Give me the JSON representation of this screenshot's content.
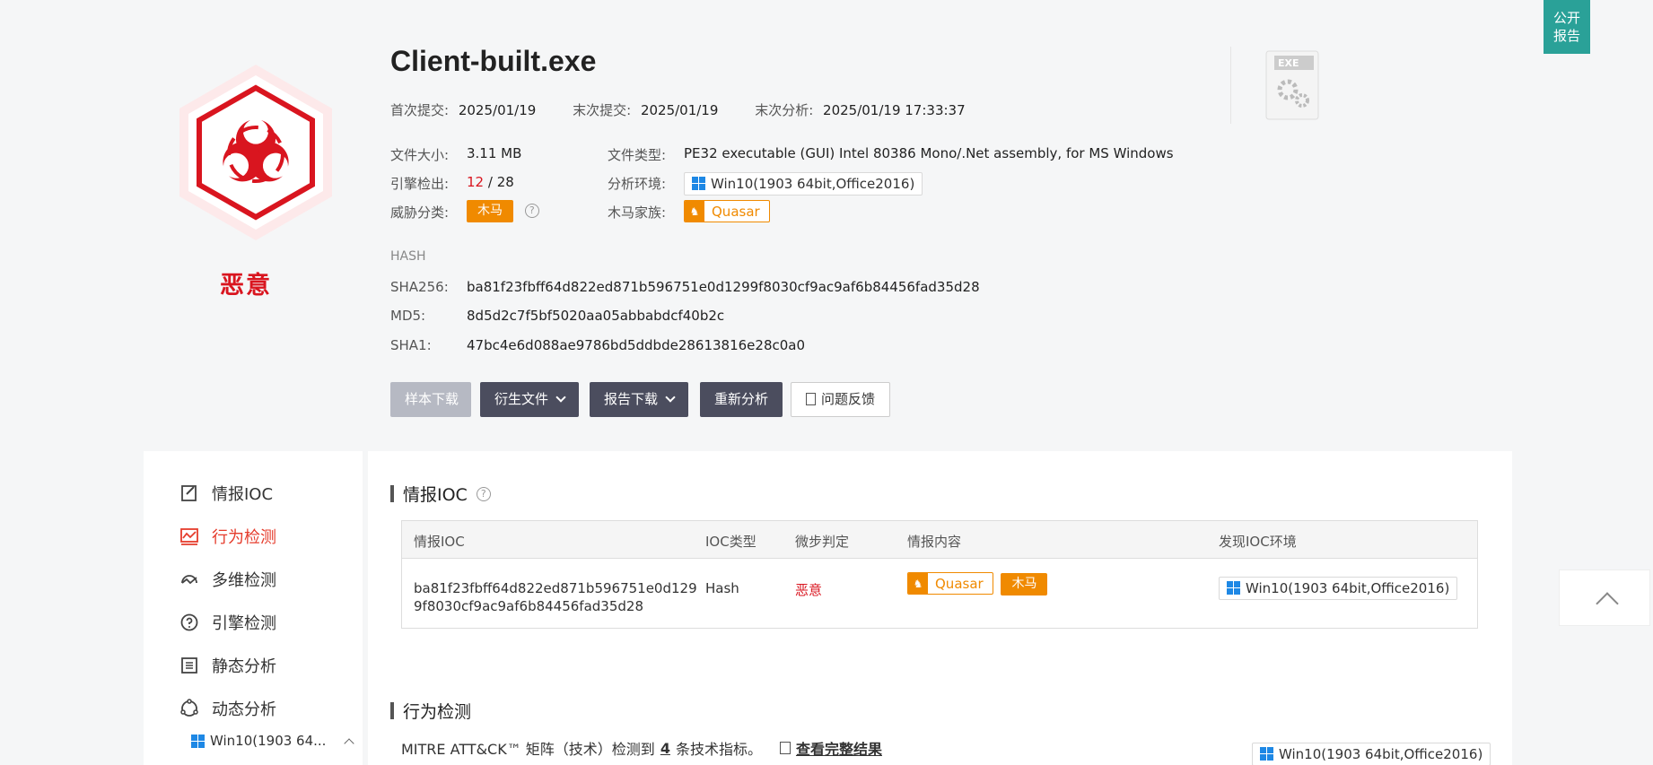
{
  "file": {
    "name": "Client-built.exe",
    "verdict": "恶意"
  },
  "submit": {
    "first_label": "首次提交:",
    "first_value": "2025/01/19",
    "last_label": "末次提交:",
    "last_value": "2025/01/19",
    "analysis_label": "末次分析:",
    "analysis_value": "2025/01/19 17:33:37"
  },
  "meta": {
    "size_label": "文件大小:",
    "size_value": "3.11 MB",
    "type_label": "文件类型:",
    "type_value": "PE32 executable (GUI) Intel 80386 Mono/.Net assembly, for MS Windows",
    "engine_label": "引擎检出:",
    "engine_hits": "12",
    "engine_total": "/ 28",
    "env_label": "分析环境:",
    "env_value": "Win10(1903 64bit,Office2016)",
    "threat_label": "威胁分类:",
    "threat_value": "木马",
    "family_label": "木马家族:",
    "family_value": "Quasar"
  },
  "hash": {
    "section_label": "HASH",
    "sha256_label": "SHA256:",
    "sha256": "ba81f23fbff64d822ed871b596751e0d1299f8030cf9ac9af6b84456fad35d28",
    "md5_label": "MD5:",
    "md5": "8d5d2c7f5bf5020aa05abbabdcf40b2c",
    "sha1_label": "SHA1:",
    "sha1": "47bc4e6d088ae9786bd5ddbde28613816e28c0a0"
  },
  "actions": {
    "download_sample": "样本下载",
    "derived_files": "衍生文件",
    "report_download": "报告下载",
    "reanalyze": "重新分析",
    "feedback": "问题反馈"
  },
  "exe_icon_text": "EXE",
  "publish_label_1": "公开",
  "publish_label_2": "报告",
  "sidebar": {
    "items": [
      {
        "label": "情报IOC"
      },
      {
        "label": "行为检测"
      },
      {
        "label": "多维检测"
      },
      {
        "label": "引擎检测"
      },
      {
        "label": "静态分析"
      },
      {
        "label": "动态分析"
      }
    ],
    "sub_env": "Win10(1903 64..."
  },
  "ioc": {
    "title": "情报IOC",
    "headers": [
      "情报IOC",
      "IOC类型",
      "微步判定",
      "情报内容",
      "发现IOC环境"
    ],
    "row": {
      "ioc_line1": "ba81f23fbff64d822ed871b596751e0d129",
      "ioc_line2": "9f8030cf9ac9af6b84456fad35d28",
      "type": "Hash",
      "verdict": "恶意",
      "family": "Quasar",
      "category": "木马",
      "env": "Win10(1903 64bit,Office2016)"
    }
  },
  "behavior": {
    "title": "行为检测",
    "mitre_prefix": "MITRE ATT&CK™ 矩阵（技术）检测到",
    "mitre_count": "4",
    "mitre_suffix": "条技术指标。",
    "view_full": "查看完整结果",
    "env": "Win10(1903 64bit,Office2016)"
  },
  "colors": {
    "malicious": "#d9151f",
    "accent": "#e53c2c",
    "orange": "#f08a00",
    "dark_button": "#4b4d5e",
    "publish": "#2aa198"
  }
}
